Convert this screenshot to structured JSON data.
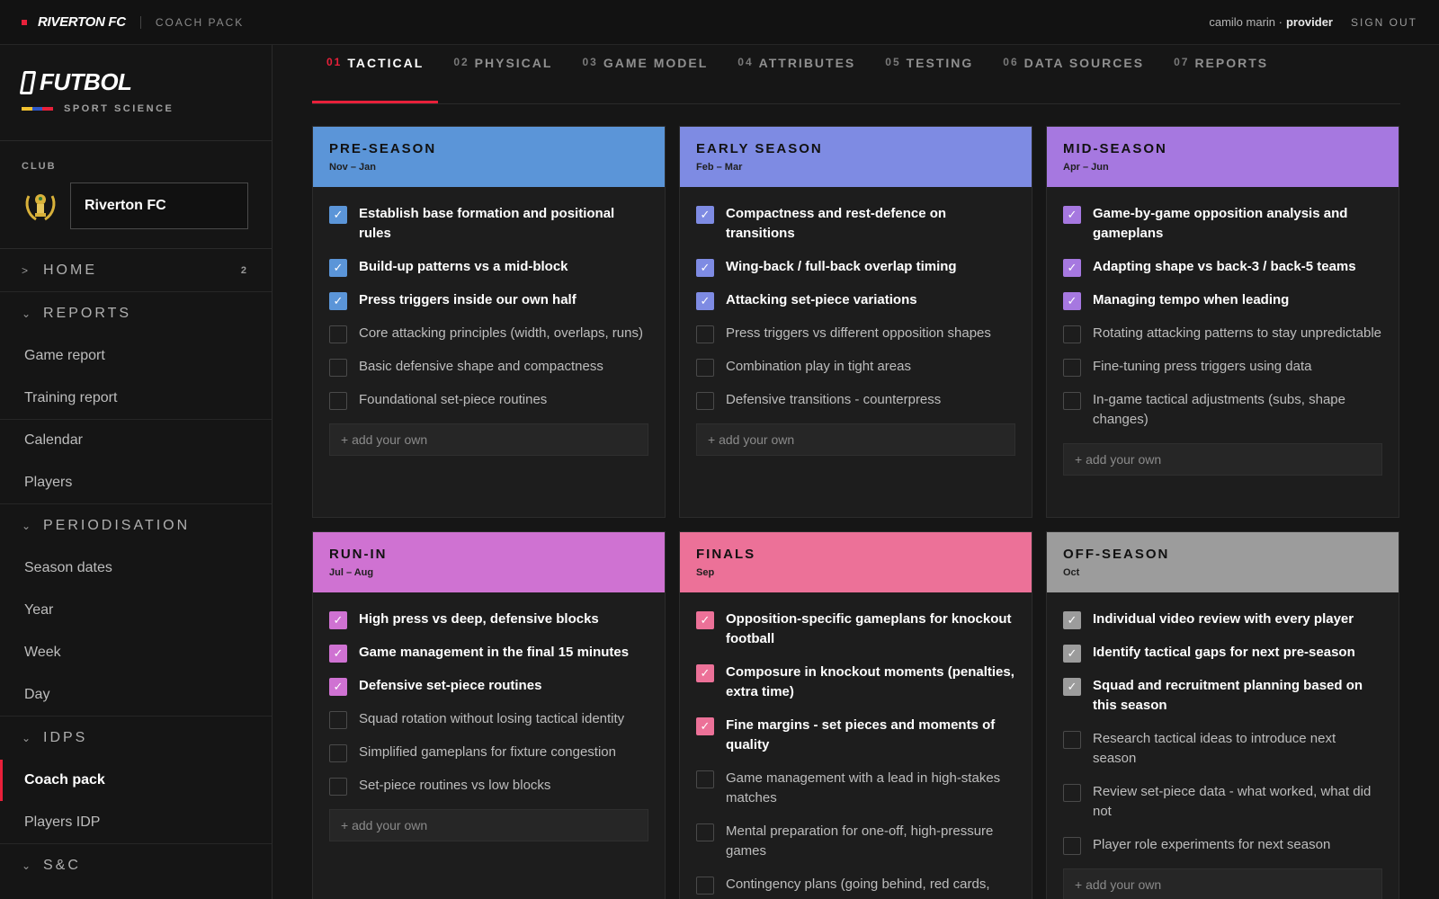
{
  "topbar": {
    "brand": "RIVERTON FC",
    "section": "COACH PACK",
    "user": "camilo marin ·",
    "role": "provider",
    "signout": "SIGN OUT"
  },
  "logo": {
    "name": "FUTBOL",
    "subtitle": "SPORT SCIENCE"
  },
  "club": {
    "label": "CLUB",
    "name": "Riverton FC"
  },
  "nav": {
    "home": {
      "label": "HOME",
      "count": "2"
    },
    "reports": {
      "label": "REPORTS",
      "items": [
        "Game report",
        "Training report",
        "Calendar",
        "Players"
      ]
    },
    "periodisation": {
      "label": "PERIODISATION",
      "items": [
        "Season dates",
        "Year",
        "Week",
        "Day"
      ]
    },
    "idps": {
      "label": "IDPS",
      "items": [
        "Coach pack",
        "Players IDP"
      ]
    },
    "sc": {
      "label": "S&C"
    }
  },
  "tabs": [
    {
      "num": "01",
      "label": "TACTICAL"
    },
    {
      "num": "02",
      "label": "PHYSICAL"
    },
    {
      "num": "03",
      "label": "GAME MODEL"
    },
    {
      "num": "04",
      "label": "ATTRIBUTES"
    },
    {
      "num": "05",
      "label": "TESTING"
    },
    {
      "num": "06",
      "label": "DATA SOURCES"
    },
    {
      "num": "07",
      "label": "REPORTS"
    }
  ],
  "active_tab": 0,
  "add_placeholder": "+ add your own",
  "phases": [
    {
      "title": "PRE-SEASON",
      "dates": "Nov – Jan",
      "color": "#5b95d8",
      "items": [
        {
          "text": "Establish base formation and positional rules",
          "checked": true
        },
        {
          "text": "Build-up patterns vs a mid-block",
          "checked": true
        },
        {
          "text": "Press triggers inside our own half",
          "checked": true
        },
        {
          "text": "Core attacking principles (width, overlaps, runs)",
          "checked": false
        },
        {
          "text": "Basic defensive shape and compactness",
          "checked": false
        },
        {
          "text": "Foundational set-piece routines",
          "checked": false
        }
      ]
    },
    {
      "title": "EARLY SEASON",
      "dates": "Feb – Mar",
      "color": "#7e8be3",
      "items": [
        {
          "text": "Compactness and rest-defence on transitions",
          "checked": true
        },
        {
          "text": "Wing-back / full-back overlap timing",
          "checked": true
        },
        {
          "text": "Attacking set-piece variations",
          "checked": true
        },
        {
          "text": "Press triggers vs different opposition shapes",
          "checked": false
        },
        {
          "text": "Combination play in tight areas",
          "checked": false
        },
        {
          "text": "Defensive transitions - counterpress",
          "checked": false
        }
      ]
    },
    {
      "title": "MID-SEASON",
      "dates": "Apr – Jun",
      "color": "#a678e0",
      "items": [
        {
          "text": "Game-by-game opposition analysis and gameplans",
          "checked": true
        },
        {
          "text": "Adapting shape vs back-3 / back-5 teams",
          "checked": true
        },
        {
          "text": "Managing tempo when leading",
          "checked": true
        },
        {
          "text": "Rotating attacking patterns to stay unpredictable",
          "checked": false
        },
        {
          "text": "Fine-tuning press triggers using data",
          "checked": false
        },
        {
          "text": "In-game tactical adjustments (subs, shape changes)",
          "checked": false
        }
      ]
    },
    {
      "title": "RUN-IN",
      "dates": "Jul – Aug",
      "color": "#cf72d2",
      "items": [
        {
          "text": "High press vs deep, defensive blocks",
          "checked": true
        },
        {
          "text": "Game management in the final 15 minutes",
          "checked": true
        },
        {
          "text": "Defensive set-piece routines",
          "checked": true
        },
        {
          "text": "Squad rotation without losing tactical identity",
          "checked": false
        },
        {
          "text": "Simplified gameplans for fixture congestion",
          "checked": false
        },
        {
          "text": "Set-piece routines vs low blocks",
          "checked": false
        }
      ]
    },
    {
      "title": "FINALS",
      "dates": "Sep",
      "color": "#ec7198",
      "items": [
        {
          "text": "Opposition-specific gameplans for knockout football",
          "checked": true
        },
        {
          "text": "Composure in knockout moments (penalties, extra time)",
          "checked": true
        },
        {
          "text": "Fine margins - set pieces and moments of quality",
          "checked": true
        },
        {
          "text": "Game management with a lead in high-stakes matches",
          "checked": false
        },
        {
          "text": "Mental preparation for one-off, high-pressure games",
          "checked": false
        },
        {
          "text": "Contingency plans (going behind, red cards,",
          "checked": false
        }
      ]
    },
    {
      "title": "OFF-SEASON",
      "dates": "Oct",
      "color": "#9c9c9c",
      "items": [
        {
          "text": "Individual video review with every player",
          "checked": true
        },
        {
          "text": "Identify tactical gaps for next pre-season",
          "checked": true
        },
        {
          "text": "Squad and recruitment planning based on this season",
          "checked": true
        },
        {
          "text": "Research tactical ideas to introduce next season",
          "checked": false
        },
        {
          "text": "Review set-piece data - what worked, what did not",
          "checked": false
        },
        {
          "text": "Player role experiments for next season",
          "checked": false
        }
      ]
    }
  ]
}
